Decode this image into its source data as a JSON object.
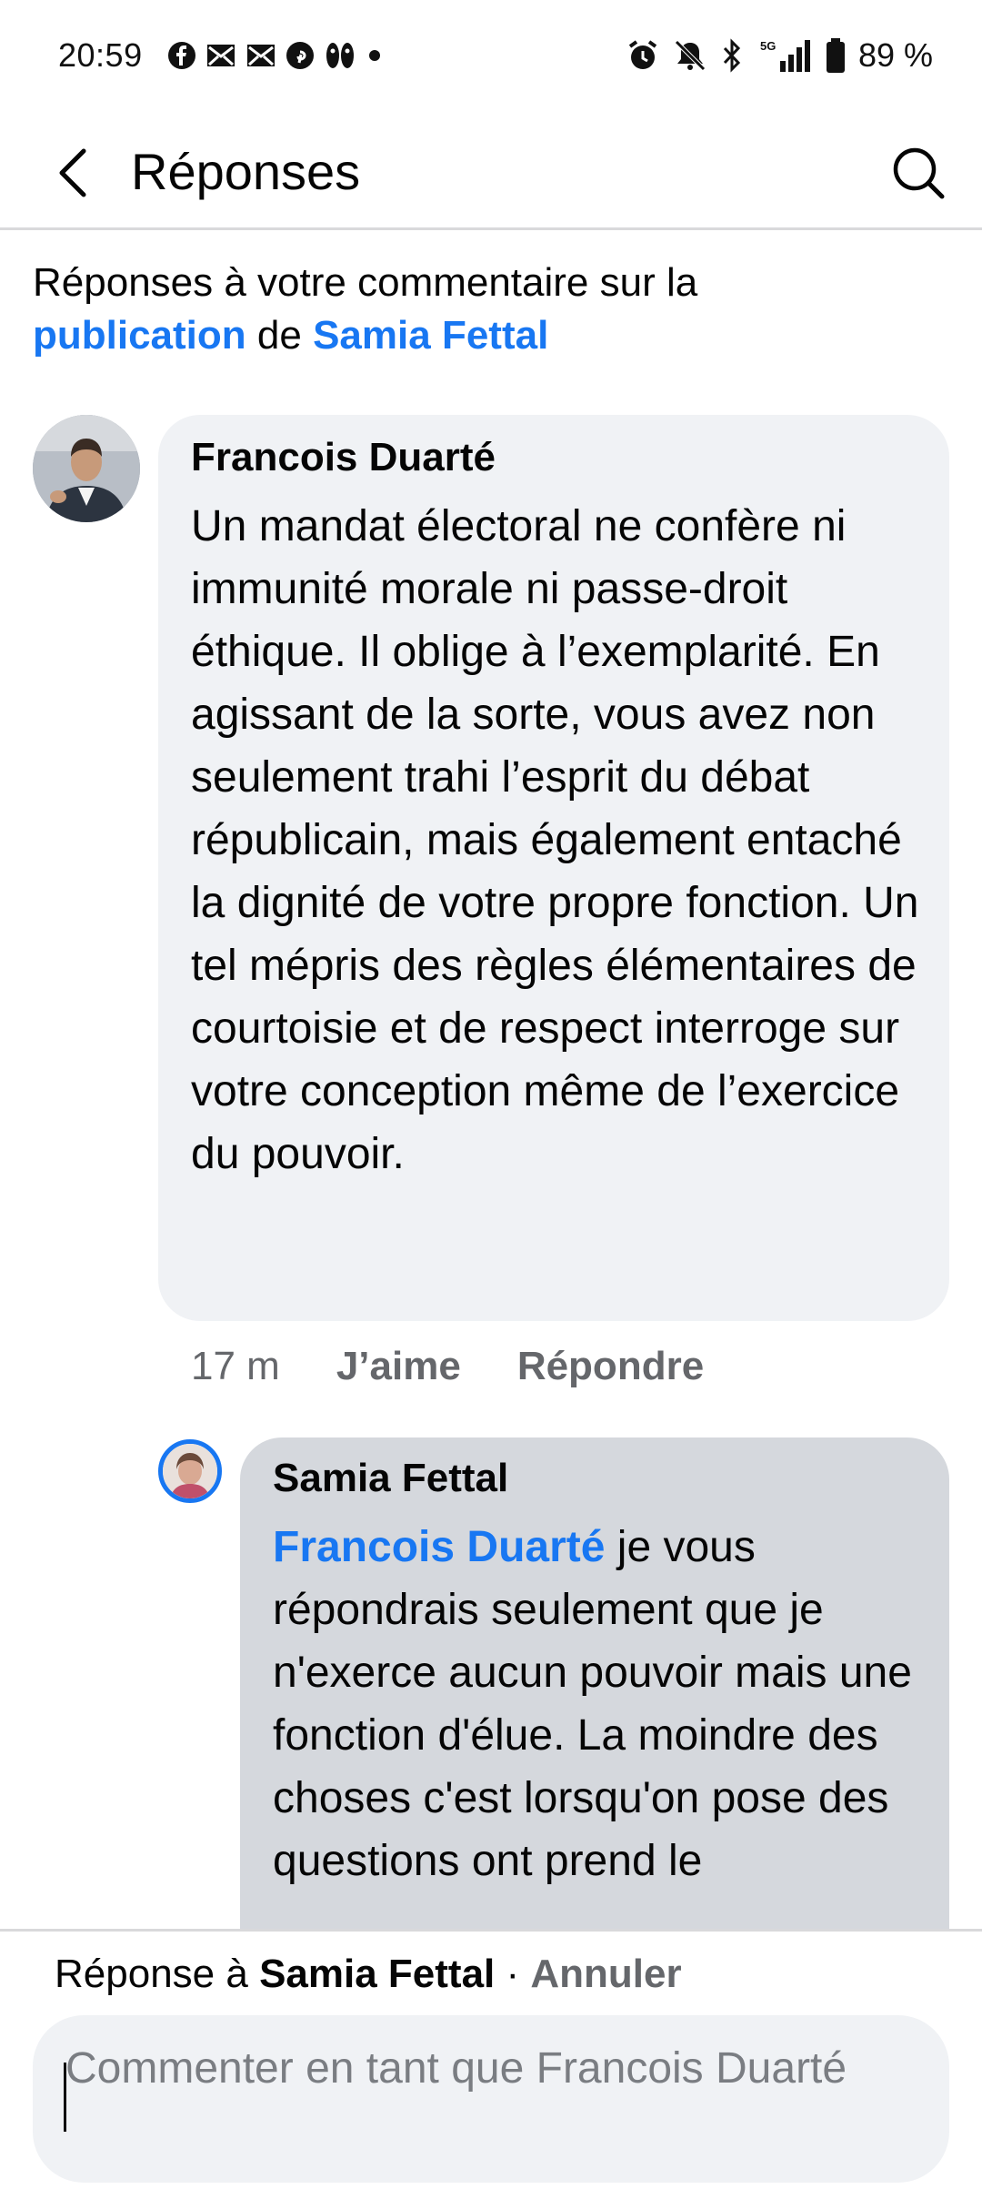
{
  "status_bar": {
    "time": "20:59",
    "battery": "89 %",
    "left_icons": [
      "facebook-icon",
      "mail-icon",
      "mail-icon",
      "pinterest-icon",
      "app-icon",
      "dot-icon"
    ],
    "right_icons": [
      "alarm-icon",
      "mute-icon",
      "bluetooth-icon",
      "signal-5g-icon",
      "battery-icon"
    ]
  },
  "header": {
    "title": "Réponses"
  },
  "context": {
    "prefix": "Réponses à votre commentaire sur la",
    "publication_link": "publication",
    "connector": "de",
    "author_link": "Samia Fettal"
  },
  "comment": {
    "author": "Francois Duarté",
    "text": "Un mandat électoral ne confère ni immunité morale ni passe-droit éthique. Il oblige à l’exemplarité. En agissant de la sorte, vous avez non seulement trahi l’esprit du débat républicain, mais également entaché la dignité de votre propre fonction. Un tel mépris des règles élémentaires de courtoisie et de respect interroge sur votre conception même de l’exercice du pouvoir.",
    "time": "17 m",
    "like_label": "J’aime",
    "reply_label": "Répondre"
  },
  "reply": {
    "author": "Samia Fettal",
    "mention": "Francois Duarté",
    "text": " je vous répondrais seulement que je n'exerce aucun pouvoir mais une fonction d'élue. La moindre des choses c'est lorsqu'on pose des questions ont prend le"
  },
  "composer": {
    "replying_to_prefix": "Réponse à ",
    "replying_to_name": "Samia Fettal",
    "separator": " · ",
    "cancel_label": "Annuler",
    "placeholder": "Commenter en tant que Francois Duarté"
  },
  "colors": {
    "accent": "#1877f2",
    "bubble": "#f0f2f5",
    "bubble_selected": "#d5d8dd",
    "secondary_text": "#65676b"
  }
}
